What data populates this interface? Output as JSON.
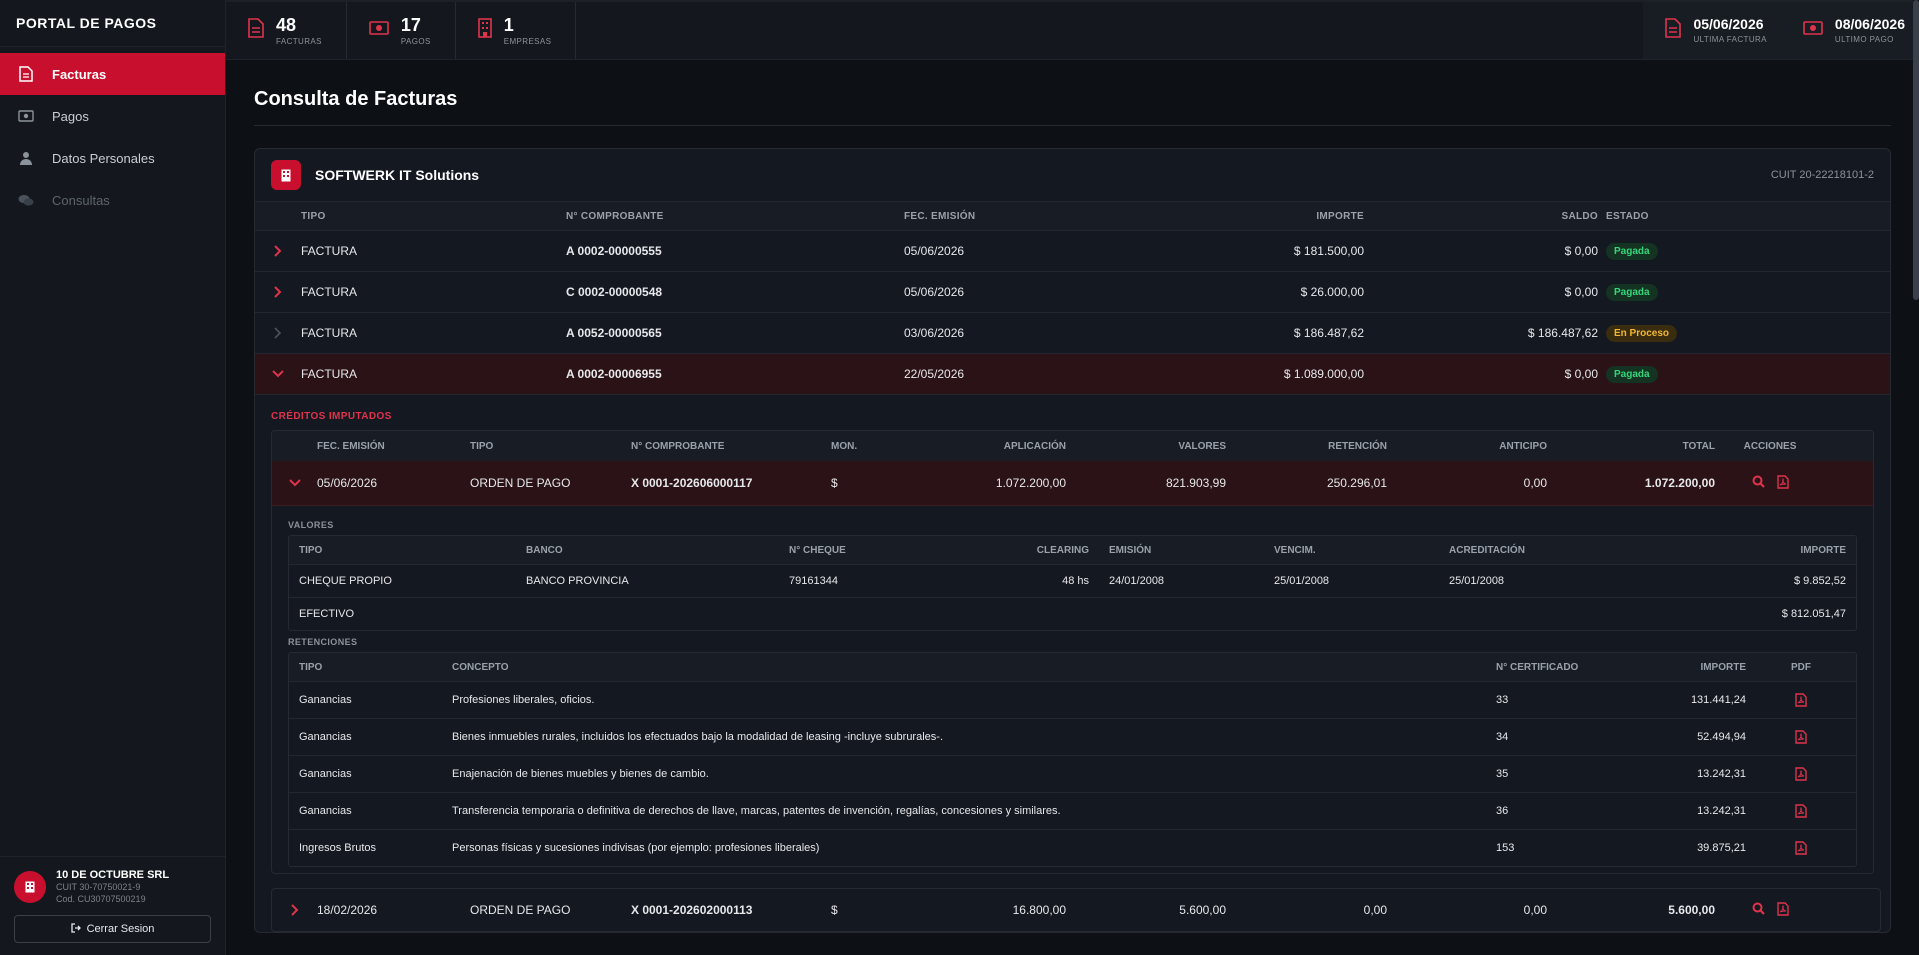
{
  "sidebar": {
    "brand": "PORTAL DE PAGOS",
    "items": [
      {
        "label": "Facturas",
        "icon": "file-icon",
        "active": true
      },
      {
        "label": "Pagos",
        "icon": "money-icon"
      },
      {
        "label": "Datos Personales",
        "icon": "user-icon"
      },
      {
        "label": "Consultas",
        "icon": "chat-icon",
        "disabled": true
      }
    ],
    "user": {
      "name": "10 DE OCTUBRE SRL",
      "cuit": "CUIT 30-70750021-9",
      "cod": "Cod. CU30707500219"
    },
    "logout_label": "Cerrar Sesion"
  },
  "topbar": {
    "stats": [
      {
        "value": "48",
        "label": "FACTURAS"
      },
      {
        "value": "17",
        "label": "PAGOS"
      },
      {
        "value": "1",
        "label": "EMPRESAS"
      }
    ],
    "right": [
      {
        "value": "05/06/2026",
        "label": "ULTIMA FACTURA"
      },
      {
        "value": "08/06/2026",
        "label": "ULTIMO PAGO"
      }
    ]
  },
  "page": {
    "title": "Consulta de Facturas"
  },
  "company": {
    "name": "SOFTWERK IT Solutions",
    "cuit": "CUIT 20-22218101-2"
  },
  "invoice_headers": {
    "tipo": "TIPO",
    "comp": "N° COMPROBANTE",
    "fec": "FEC. EMISIÓN",
    "imp": "IMPORTE",
    "saldo": "SALDO",
    "estado": "ESTADO"
  },
  "invoices": [
    {
      "tipo": "FACTURA",
      "comp": "A 0002-00000555",
      "fec": "05/06/2026",
      "imp": "$ 181.500,00",
      "saldo": "$ 0,00",
      "estado": "Pagada"
    },
    {
      "tipo": "FACTURA",
      "comp": "C 0002-00000548",
      "fec": "05/06/2026",
      "imp": "$ 26.000,00",
      "saldo": "$ 0,00",
      "estado": "Pagada"
    },
    {
      "tipo": "FACTURA",
      "comp": "A 0052-00000565",
      "fec": "03/06/2026",
      "imp": "$ 186.487,62",
      "saldo": "$ 186.487,62",
      "estado": "En Proceso"
    },
    {
      "tipo": "FACTURA",
      "comp": "A 0002-00006955",
      "fec": "22/05/2026",
      "imp": "$ 1.089.000,00",
      "saldo": "$ 0,00",
      "estado": "Pagada"
    }
  ],
  "credits": {
    "title": "CRÉDITOS IMPUTADOS",
    "headers": {
      "fec": "FEC. EMISIÓN",
      "tipo": "TIPO",
      "comp": "N° COMPROBANTE",
      "mon": "MON.",
      "apl": "APLICACIÓN",
      "val": "VALORES",
      "ret": "RETENCIÓN",
      "ant": "ANTICIPO",
      "tot": "TOTAL",
      "acc": "ACCIONES"
    },
    "rows": [
      {
        "fec": "05/06/2026",
        "tipo": "ORDEN DE PAGO",
        "comp": "X 0001-202606000117",
        "mon": "$",
        "apl": "1.072.200,00",
        "val": "821.903,99",
        "ret": "250.296,01",
        "ant": "0,00",
        "tot": "1.072.200,00"
      },
      {
        "fec": "18/02/2026",
        "tipo": "ORDEN DE PAGO",
        "comp": "X 0001-202602000113",
        "mon": "$",
        "apl": "16.800,00",
        "val": "5.600,00",
        "ret": "0,00",
        "ant": "0,00",
        "tot": "5.600,00"
      }
    ]
  },
  "valores": {
    "label": "VALORES",
    "headers": {
      "tipo": "TIPO",
      "banco": "BANCO",
      "cheque": "N° CHEQUE",
      "clear": "CLEARING",
      "emi": "EMISIÓN",
      "ven": "VENCIM.",
      "acr": "ACREDITACIÓN",
      "imp": "IMPORTE"
    },
    "rows": [
      {
        "tipo": "CHEQUE PROPIO",
        "banco": "BANCO PROVINCIA",
        "cheque": "79161344",
        "clear": "48 hs",
        "emi": "24/01/2008",
        "ven": "25/01/2008",
        "acr": "25/01/2008",
        "imp": "$ 9.852,52"
      },
      {
        "tipo": "EFECTIVO",
        "banco": "",
        "cheque": "",
        "clear": "",
        "emi": "",
        "ven": "",
        "acr": "",
        "imp": "$ 812.051,47"
      }
    ]
  },
  "retenciones": {
    "label": "RETENCIONES",
    "headers": {
      "tipo": "TIPO",
      "conc": "CONCEPTO",
      "cert": "N° CERTIFICADO",
      "imp": "IMPORTE",
      "pdf": "PDF"
    },
    "rows": [
      {
        "tipo": "Ganancias",
        "conc": "Profesiones liberales, oficios.",
        "cert": "33",
        "imp": "131.441,24"
      },
      {
        "tipo": "Ganancias",
        "conc": "Bienes inmuebles rurales, incluidos los efectuados bajo la modalidad de leasing -incluye subrurales-.",
        "cert": "34",
        "imp": "52.494,94"
      },
      {
        "tipo": "Ganancias",
        "conc": "Enajenación de bienes muebles y bienes de cambio.",
        "cert": "35",
        "imp": "13.242,31"
      },
      {
        "tipo": "Ganancias",
        "conc": "Transferencia temporaria o definitiva de derechos de llave, marcas, patentes de invención, regalías, concesiones y similares.",
        "cert": "36",
        "imp": "13.242,31"
      },
      {
        "tipo": "Ingresos Brutos",
        "conc": "Personas físicas y sucesiones indivisas (por ejemplo: profesiones liberales)",
        "cert": "153",
        "imp": "39.875,21"
      }
    ]
  },
  "colors": {
    "accent": "#c8102e",
    "ok": "#37d67a",
    "warn": "#f2b733"
  }
}
